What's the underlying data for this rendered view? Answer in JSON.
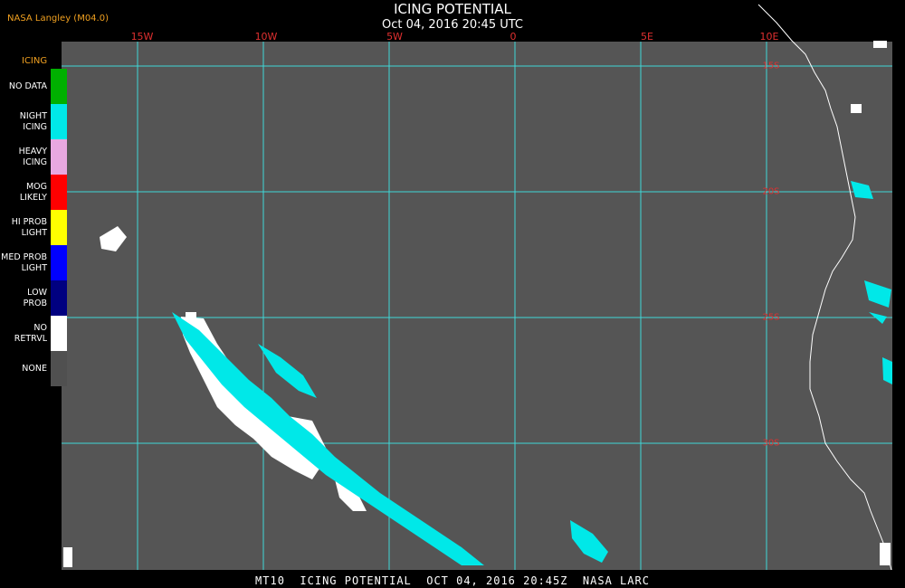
{
  "header": {
    "source": "NASA Langley (M04.0)",
    "title": "ICING POTENTIAL",
    "subtitle": "Oct 04, 2016 20:45 UTC"
  },
  "legend": {
    "title": "ICING",
    "items": [
      {
        "label": "NO DATA",
        "color": "#00b000"
      },
      {
        "label": "NIGHT\nICING",
        "color": "#00e8e8"
      },
      {
        "label": "HEAVY\nICING",
        "color": "#e8a8e0"
      },
      {
        "label": "MOG\nLIKELY",
        "color": "#ff0000"
      },
      {
        "label": "HI PROB\nLIGHT",
        "color": "#ffff00"
      },
      {
        "label": "MED PROB\nLIGHT",
        "color": "#0000ff"
      },
      {
        "label": "LOW\nPROB",
        "color": "#000080"
      },
      {
        "label": "NO\nRETRVL",
        "color": "#ffffff"
      },
      {
        "label": "NONE",
        "color": "#505050"
      }
    ]
  },
  "map": {
    "background": "#555555",
    "gridline_color": "#40d8d8",
    "longitude_labels": [
      "15W",
      "10W",
      "5W",
      "0",
      "5E",
      "10E"
    ],
    "latitude_labels": [
      "15S",
      "20S",
      "25S",
      "30S"
    ]
  },
  "footer": "MT10  ICING POTENTIAL  OCT 04, 2016 20:45Z  NASA LARC"
}
